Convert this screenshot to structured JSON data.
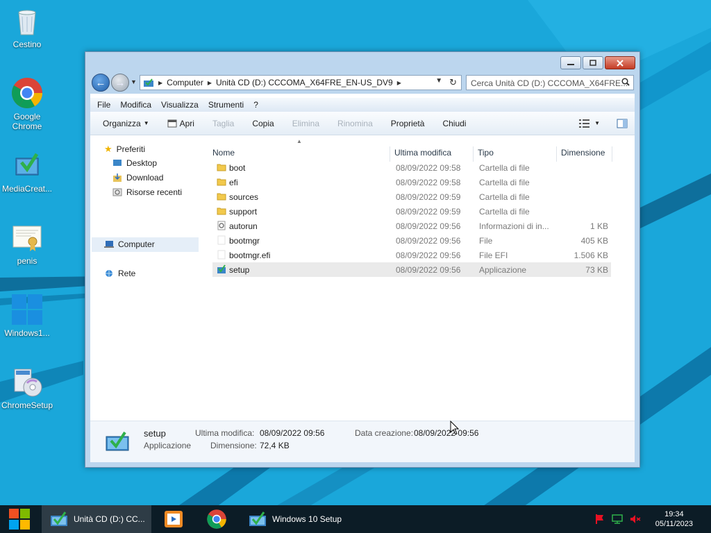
{
  "desktop": {
    "icons": [
      {
        "label": "Cestino",
        "icon": "recycle-bin-icon"
      },
      {
        "label": "Google Chrome",
        "icon": "chrome-icon"
      },
      {
        "label": "MediaCreat...",
        "icon": "media-creation-tool-icon"
      },
      {
        "label": "penis",
        "icon": "certificate-icon"
      },
      {
        "label": "Windows1...",
        "icon": "windows-logo-icon"
      },
      {
        "label": "ChromeSetup",
        "icon": "setup-disc-icon"
      }
    ]
  },
  "window": {
    "address": {
      "crumb1": "Computer",
      "crumb2": "Unità CD (D:) CCCOMA_X64FRE_EN-US_DV9"
    },
    "search_placeholder": "Cerca Unità CD (D:) CCCOMA_X64FRE...",
    "menu": [
      "File",
      "Modifica",
      "Visualizza",
      "Strumenti",
      "?"
    ],
    "toolbar": {
      "organize": "Organizza",
      "open": "Apri",
      "cut": "Taglia",
      "copy": "Copia",
      "delete": "Elimina",
      "rename": "Rinomina",
      "properties": "Proprietà",
      "close": "Chiudi"
    },
    "nav": {
      "favorites": "Preferiti",
      "desktop": "Desktop",
      "download": "Download",
      "recent": "Risorse recenti",
      "computer": "Computer",
      "network": "Rete"
    },
    "columns": {
      "name": "Nome",
      "modified": "Ultima modifica",
      "type": "Tipo",
      "size": "Dimensione"
    },
    "files": [
      {
        "name": "boot",
        "modified": "08/09/2022 09:58",
        "type": "Cartella di file",
        "size": "",
        "icon": "folder-icon"
      },
      {
        "name": "efi",
        "modified": "08/09/2022 09:58",
        "type": "Cartella di file",
        "size": "",
        "icon": "folder-icon"
      },
      {
        "name": "sources",
        "modified": "08/09/2022 09:59",
        "type": "Cartella di file",
        "size": "",
        "icon": "folder-icon"
      },
      {
        "name": "support",
        "modified": "08/09/2022 09:59",
        "type": "Cartella di file",
        "size": "",
        "icon": "folder-icon"
      },
      {
        "name": "autorun",
        "modified": "08/09/2022 09:56",
        "type": "Informazioni di in...",
        "size": "1 KB",
        "icon": "settings-file-icon"
      },
      {
        "name": "bootmgr",
        "modified": "08/09/2022 09:56",
        "type": "File",
        "size": "405 KB",
        "icon": "file-icon"
      },
      {
        "name": "bootmgr.efi",
        "modified": "08/09/2022 09:56",
        "type": "File EFI",
        "size": "1.506 KB",
        "icon": "file-icon"
      },
      {
        "name": "setup",
        "modified": "08/09/2022 09:56",
        "type": "Applicazione",
        "size": "73 KB",
        "icon": "setup-app-icon",
        "selected": true
      }
    ],
    "details": {
      "name": "setup",
      "type": "Applicazione",
      "modified_label": "Ultima modifica:",
      "modified_value": "08/09/2022 09:56",
      "size_label": "Dimensione:",
      "size_value": "72,4 KB",
      "created_label": "Data creazione:",
      "created_value": "08/09/2022 09:56"
    }
  },
  "taskbar": {
    "items": [
      {
        "label": "Unità CD (D:) CC..."
      },
      {
        "label": "Windows 10 Setup"
      }
    ],
    "time": "19:34",
    "date": "05/11/2023"
  }
}
